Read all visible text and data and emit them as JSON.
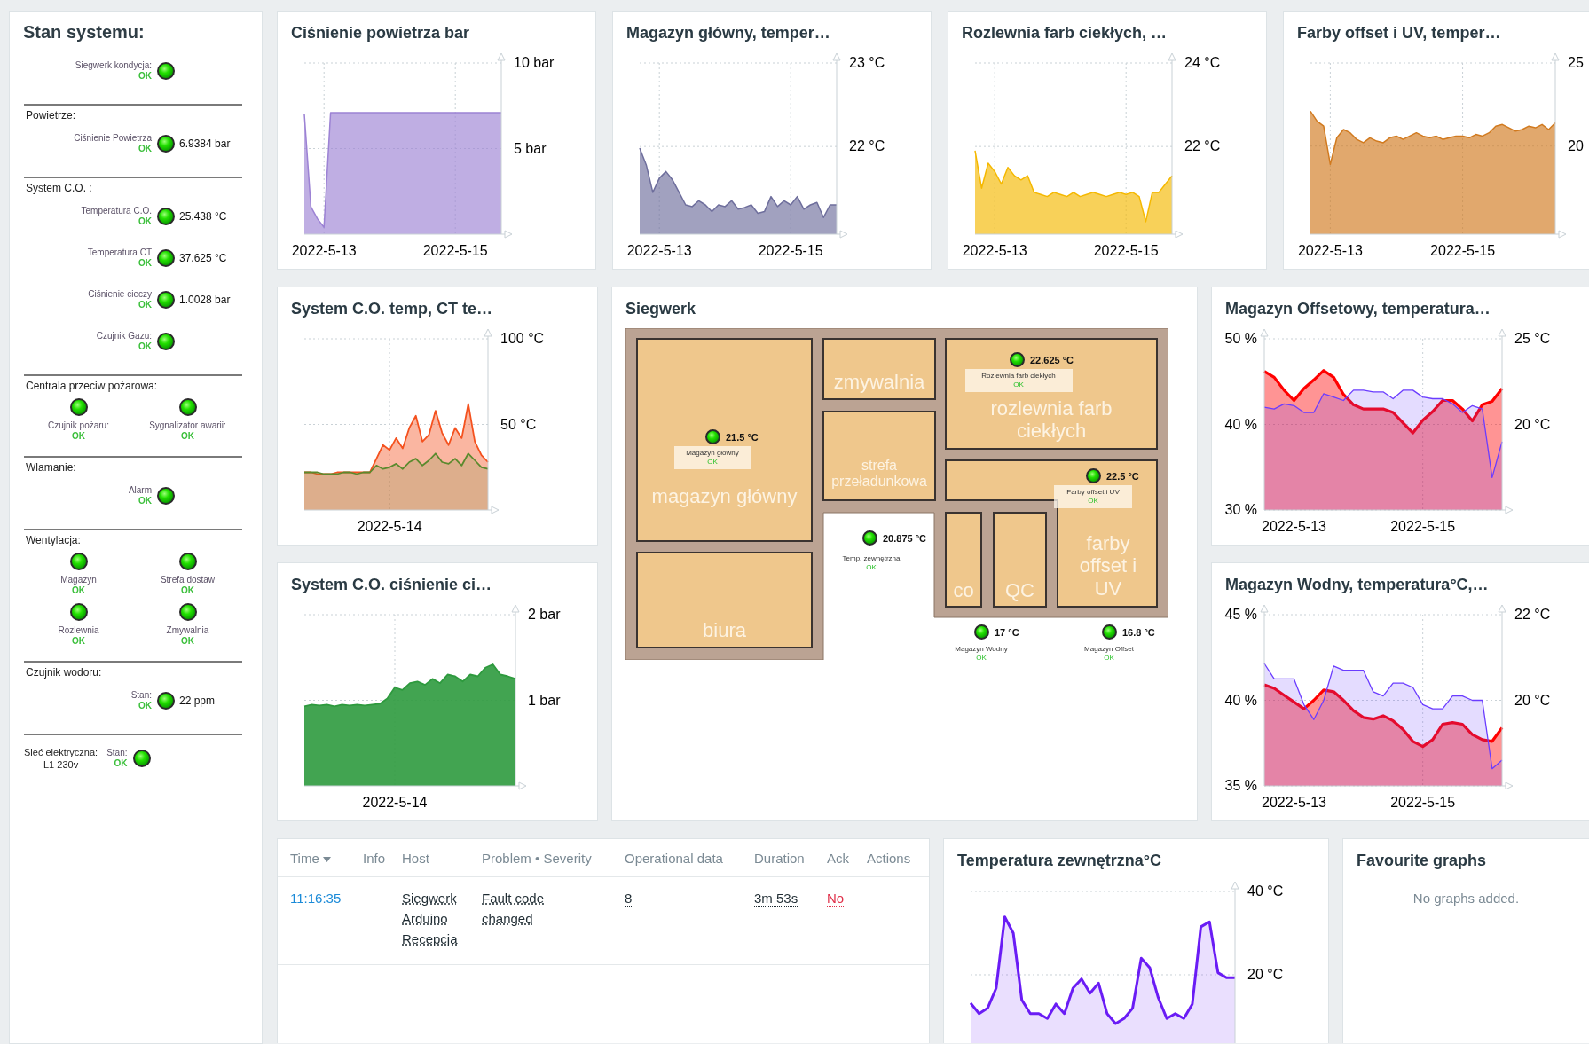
{
  "system_status": {
    "title": "Stan systemu:",
    "sections": [
      {
        "kind": "rows",
        "items": [
          {
            "label": "Siegwerk kondycja:",
            "status": "OK"
          }
        ]
      },
      {
        "kind": "rows",
        "heading": "Powietrze:",
        "items": [
          {
            "label": "Ciśnienie Powietrza",
            "status": "OK",
            "value": "6.9384 bar"
          }
        ]
      },
      {
        "kind": "rows",
        "heading": "System C.O. :",
        "items": [
          {
            "label": "Temperatura C.O.",
            "status": "OK",
            "value": "25.438 °C"
          },
          {
            "label": "Temperatura CT",
            "status": "OK",
            "value": "37.625 °C"
          },
          {
            "label": "Ciśnienie cieczy",
            "status": "OK",
            "value": "1.0028 bar"
          },
          {
            "label": "Czujnik Gazu:",
            "status": "OK"
          }
        ]
      },
      {
        "kind": "grid",
        "heading": "Centrala przeciw pożarowa:",
        "items": [
          {
            "label": "Czujnik pożaru:",
            "status": "OK"
          },
          {
            "label": "Sygnalizator awarii:",
            "status": "OK"
          }
        ]
      },
      {
        "kind": "rows",
        "heading": "Wlamanie:",
        "items": [
          {
            "label": "Alarm",
            "status": "OK"
          }
        ]
      },
      {
        "kind": "grid",
        "heading": "Wentylacja:",
        "items": [
          {
            "label": "Magazyn",
            "status": "OK"
          },
          {
            "label": "Strefa dostaw",
            "status": "OK"
          },
          {
            "label": "Rozlewnia",
            "status": "OK"
          },
          {
            "label": "Zmywalnia",
            "status": "OK"
          }
        ]
      },
      {
        "kind": "rows",
        "heading": "Czujnik wodoru:",
        "items": [
          {
            "label": "Stan:",
            "status": "OK",
            "value": "22 ppm"
          }
        ]
      },
      {
        "kind": "inline",
        "heading": "Sieć elektryczna:",
        "subheading": "L1 230v",
        "items": [
          {
            "label": "Stan:",
            "status": "OK"
          }
        ]
      }
    ]
  },
  "top_graphs": [
    {
      "title": "Ciśnienie powietrza bar",
      "chart_data": {
        "type": "area",
        "grid": true,
        "categories": [
          null,
          null,
          null,
          "2022-5-13",
          null,
          null,
          null,
          null,
          null,
          null,
          null,
          null,
          null,
          null,
          null,
          null,
          null,
          null,
          null,
          null,
          null,
          null,
          null,
          "2022-5-15",
          null,
          null,
          null,
          null,
          null,
          null,
          null
        ],
        "ylim": [
          0,
          10
        ],
        "yticks": [
          {
            "value": 10,
            "label": "10 bar"
          },
          {
            "value": 5,
            "label": "5 bar"
          }
        ],
        "series": [
          {
            "color": "#9c82d4",
            "values": [
              7.0,
              1.6,
              0.9,
              0.4,
              7.1,
              7.1,
              7.1,
              7.1,
              7.1,
              7.1,
              7.1,
              7.1,
              7.1,
              7.1,
              7.1,
              7.1,
              7.1,
              7.1,
              7.1,
              7.1,
              7.1,
              7.1,
              7.1,
              7.1,
              7.1,
              7.1,
              7.1,
              7.1,
              7.1,
              7.1,
              7.1
            ]
          }
        ]
      }
    },
    {
      "title": "Magazyn główny, temper…",
      "chart_data": {
        "type": "area",
        "grid": true,
        "categories": [
          null,
          null,
          null,
          "2022-5-13",
          null,
          null,
          null,
          null,
          null,
          null,
          null,
          null,
          null,
          null,
          null,
          null,
          null,
          null,
          null,
          null,
          null,
          null,
          null,
          "2022-5-15",
          null,
          null,
          null,
          null,
          null,
          null,
          null
        ],
        "ylim": [
          20.95,
          23
        ],
        "yticks": [
          {
            "value": 23,
            "label": "23 °C"
          },
          {
            "value": 22,
            "label": "22 °C"
          }
        ],
        "series": [
          {
            "color": "#6e6e9c",
            "values": [
              21.98,
              21.78,
              21.45,
              21.62,
              21.7,
              21.6,
              21.45,
              21.3,
              21.28,
              21.35,
              21.3,
              21.22,
              21.3,
              21.28,
              21.35,
              21.25,
              21.27,
              21.3,
              21.2,
              21.22,
              21.4,
              21.28,
              21.35,
              21.3,
              21.4,
              21.25,
              21.3,
              21.33,
              21.15,
              21.3,
              21.3
            ]
          }
        ]
      }
    },
    {
      "title": "Rozlewnia farb ciekłych, …",
      "chart_data": {
        "type": "area",
        "grid": true,
        "categories": [
          null,
          null,
          null,
          "2022-5-13",
          null,
          null,
          null,
          null,
          null,
          null,
          null,
          null,
          null,
          null,
          null,
          null,
          null,
          null,
          null,
          null,
          null,
          null,
          null,
          "2022-5-15",
          null,
          null,
          null,
          null,
          null,
          null,
          null
        ],
        "ylim": [
          19.9,
          24
        ],
        "yticks": [
          {
            "value": 24,
            "label": "24 °C"
          },
          {
            "value": 22,
            "label": "22 °C"
          }
        ],
        "series": [
          {
            "color": "#f5b800",
            "values": [
              21.9,
              21.0,
              21.6,
              21.4,
              21.1,
              21.5,
              21.3,
              21.2,
              21.3,
              20.9,
              20.85,
              20.8,
              20.9,
              20.85,
              20.8,
              20.9,
              20.8,
              20.85,
              20.9,
              20.85,
              20.8,
              20.85,
              20.9,
              20.85,
              20.9,
              20.8,
              20.2,
              20.9,
              20.9,
              21.1,
              21.3
            ]
          }
        ]
      }
    },
    {
      "title": "Farby offset i UV, temper…",
      "chart_data": {
        "type": "area",
        "grid": true,
        "categories": [
          null,
          null,
          null,
          "2022-5-13",
          null,
          null,
          null,
          null,
          null,
          null,
          null,
          null,
          null,
          null,
          null,
          null,
          null,
          null,
          null,
          null,
          null,
          null,
          null,
          "2022-5-15",
          null,
          null,
          null,
          null,
          null,
          null,
          null,
          null,
          null,
          null,
          null,
          null,
          null,
          null
        ],
        "ylim": [
          14.7,
          25
        ],
        "yticks": [
          {
            "value": 25,
            "label": "25"
          },
          {
            "value": 20,
            "label": "20"
          }
        ],
        "series": [
          {
            "color": "#d17a1f",
            "values": [
              22.1,
              21.5,
              21.2,
              18.9,
              20.5,
              21.0,
              20.8,
              20.4,
              20.2,
              20.5,
              20.3,
              20.2,
              20.5,
              20.6,
              20.4,
              20.6,
              20.8,
              20.6,
              20.5,
              20.6,
              20.4,
              20.5,
              20.6,
              20.6,
              20.5,
              20.7,
              20.6,
              20.8,
              21.2,
              21.3,
              21.1,
              20.9,
              21.0,
              21.2,
              21.1,
              21.3,
              21.0,
              21.4
            ]
          }
        ]
      }
    }
  ],
  "left_graphs": [
    {
      "title": "System C.O. temp, CT te…",
      "chart_data": {
        "type": "area",
        "grid": true,
        "categories": [
          null,
          null,
          null,
          null,
          null,
          null,
          null,
          null,
          null,
          null,
          null,
          null,
          null,
          "2022-5-14",
          null,
          null,
          null,
          null,
          null,
          null,
          null,
          null,
          null,
          null,
          null,
          null,
          null,
          null,
          null
        ],
        "ylim": [
          0,
          100
        ],
        "yticks": [
          {
            "value": 100,
            "label": "100 °C"
          },
          {
            "value": 50,
            "label": "50 °C"
          }
        ],
        "series": [
          {
            "color": "#f4511e",
            "values": [
              22,
              22,
              21,
              21,
              21,
              22,
              22,
              22,
              22,
              22,
              22,
              30,
              38,
              35,
              42,
              36,
              48,
              55,
              40,
              44,
              58,
              45,
              38,
              48,
              42,
              62,
              40,
              32,
              28
            ]
          },
          {
            "color": "#5b8a2e",
            "values": [
              22,
              22,
              22,
              21,
              21,
              21,
              22,
              22,
              21,
              22,
              22,
              26,
              24,
              25,
              27,
              24,
              28,
              30,
              26,
              29,
              33,
              28,
              27,
              30,
              26,
              33,
              29,
              25,
              24
            ]
          }
        ]
      }
    },
    {
      "title": "System C.O. ciśnienie ci…",
      "chart_data": {
        "type": "area",
        "grid": true,
        "categories": [
          null,
          null,
          null,
          null,
          null,
          null,
          null,
          null,
          null,
          null,
          null,
          null,
          "2022-5-14",
          null,
          null,
          null,
          null,
          null,
          null,
          null,
          null,
          null,
          null,
          null,
          null,
          null,
          null,
          null,
          null
        ],
        "ylim": [
          0,
          2
        ],
        "yticks": [
          {
            "value": 2,
            "label": "2 bar"
          },
          {
            "value": 1,
            "label": "1 bar"
          }
        ],
        "series": [
          {
            "color": "#2e9a3e",
            "values": [
              0.93,
              0.95,
              0.94,
              0.95,
              0.93,
              0.95,
              0.94,
              0.95,
              0.94,
              0.95,
              0.96,
              1.02,
              1.15,
              1.12,
              1.2,
              1.22,
              1.18,
              1.25,
              1.2,
              1.3,
              1.28,
              1.22,
              1.3,
              1.28,
              1.38,
              1.42,
              1.3,
              1.28,
              1.25
            ]
          }
        ]
      }
    }
  ],
  "siegwerk_map": {
    "title": "Siegwerk",
    "rooms": [
      {
        "label": "magazyn główny"
      },
      {
        "label": "biura"
      },
      {
        "label": "zmywalnia"
      },
      {
        "label": "strefa przeładunkowa"
      },
      {
        "label": "rozlewnia farb ciekłych"
      },
      {
        "label": "co"
      },
      {
        "label": "QC"
      },
      {
        "label": "farby offset i UV"
      }
    ],
    "sensors": [
      {
        "label": "Rozlewnia farb ciekłych",
        "status": "OK",
        "value": "22.625 °C"
      },
      {
        "label": "Magazyn główny",
        "status": "OK",
        "value": "21.5 °C"
      },
      {
        "label": "Farby offset i UV",
        "status": "OK",
        "value": "22.5 °C"
      },
      {
        "label": "Temp. zewnętrzna",
        "status": "OK",
        "value": "20.875 °C"
      },
      {
        "label": "Magazyn Wodny",
        "status": "OK",
        "value": "17 °C"
      },
      {
        "label": "Magazyn Offset",
        "status": "OK",
        "value": "16.8 °C"
      }
    ]
  },
  "right_graphs": [
    {
      "title": "Magazyn Offsetowy, temperatura…",
      "chart_data": {
        "type": "area",
        "grid": true,
        "categories": [
          null,
          null,
          null,
          "2022-5-13",
          null,
          null,
          null,
          null,
          null,
          null,
          null,
          null,
          null,
          null,
          null,
          null,
          "2022-5-15",
          null,
          null,
          null,
          null,
          null,
          null,
          null,
          null
        ],
        "ylim": [
          30,
          50
        ],
        "y2lim": [
          15,
          25
        ],
        "yticks": [
          {
            "value": 50,
            "label": "50 %"
          },
          {
            "value": 40,
            "label": "40 %"
          },
          {
            "value": 30,
            "label": "30 %"
          }
        ],
        "y2ticks": [
          {
            "value": 25,
            "label": "25 °C"
          },
          {
            "value": 20,
            "label": "20 °C"
          }
        ],
        "series": [
          {
            "color": "#ff0000",
            "values": [
              46.2,
              45.5,
              44,
              42.8,
              44.2,
              45.2,
              46.3,
              45.5,
              43.5,
              42.3,
              41.8,
              41.8,
              41.8,
              41.4,
              40.2,
              39,
              40.5,
              41.5,
              42.8,
              42.8,
              41.8,
              40.4,
              42.3,
              42.7,
              44.2
            ]
          },
          {
            "color": "#6a3cff",
            "axis": "y2",
            "values": [
              21.0,
              20.9,
              21.2,
              21.1,
              20.7,
              20.7,
              21.8,
              21.6,
              21.4,
              22.0,
              22.0,
              21.9,
              21.9,
              21.5,
              22.0,
              22.0,
              21.6,
              21.5,
              21.5,
              21.2,
              20.7,
              21.1,
              20.9,
              16.9,
              19.0
            ]
          }
        ]
      }
    },
    {
      "title": "Magazyn Wodny, temperatura°C,…",
      "chart_data": {
        "type": "area",
        "grid": true,
        "categories": [
          null,
          null,
          null,
          "2022-5-13",
          null,
          null,
          null,
          null,
          null,
          null,
          null,
          null,
          null,
          null,
          null,
          null,
          "2022-5-15",
          null,
          null,
          null,
          null,
          null,
          null,
          null,
          null
        ],
        "ylim": [
          35,
          45
        ],
        "y2lim": [
          18,
          22
        ],
        "yticks": [
          {
            "value": 45,
            "label": "45 %"
          },
          {
            "value": 40,
            "label": "40 %"
          },
          {
            "value": 35,
            "label": "35 %"
          }
        ],
        "y2ticks": [
          {
            "value": 22,
            "label": "22 °C"
          },
          {
            "value": 20,
            "label": "20 °C"
          }
        ],
        "series": [
          {
            "color": "#ff0000",
            "values": [
              40.9,
              40.7,
              40.3,
              39.9,
              39.5,
              40.0,
              40.6,
              40.5,
              40.0,
              39.4,
              39.0,
              38.9,
              39.1,
              38.8,
              38.3,
              37.6,
              37.3,
              37.7,
              38.6,
              38.7,
              38.6,
              38.0,
              37.7,
              37.6,
              38.4
            ]
          },
          {
            "color": "#6a3cff",
            "axis": "y2",
            "values": [
              20.86,
              20.5,
              20.5,
              20.5,
              19.9,
              19.55,
              20.0,
              20.8,
              20.7,
              20.7,
              20.7,
              20.2,
              20.1,
              20.4,
              20.4,
              20.3,
              19.9,
              19.8,
              19.8,
              20.1,
              20.1,
              20.0,
              20.0,
              18.4,
              18.6
            ]
          }
        ]
      }
    }
  ],
  "problems": {
    "columns": [
      {
        "label": "Time",
        "sorted": true
      },
      {
        "label": "Info",
        "sorted": false
      },
      {
        "label": "Host",
        "sorted": false
      },
      {
        "label": "Problem • Severity",
        "sorted": false
      },
      {
        "label": "Operational data",
        "sorted": false
      },
      {
        "label": "Duration",
        "sorted": false
      },
      {
        "label": "Ack",
        "sorted": false
      },
      {
        "label": "Actions",
        "sorted": false
      }
    ],
    "rows": [
      {
        "time": "11:16:35",
        "host": "Siegwerk Arduino Recepcja",
        "problem": "Fault code changed",
        "operational_data": "8",
        "duration": "3m 53s",
        "ack": "No"
      }
    ]
  },
  "outdoor_graph": {
    "title": "Temperatura zewnętrzna°C",
    "chart_data": {
      "type": "area",
      "grid": true,
      "categories": [
        null,
        null,
        null,
        null,
        null,
        null,
        null,
        null,
        null,
        null,
        null,
        null,
        null,
        null,
        null,
        null,
        null,
        null,
        null,
        null,
        null,
        null,
        null,
        null,
        null,
        null,
        null,
        null,
        null,
        null,
        null,
        null
      ],
      "ylim": [
        3.4,
        40
      ],
      "yticks": [
        {
          "value": 40,
          "label": "40 °C"
        },
        {
          "value": 20,
          "label": "20 °C"
        }
      ],
      "series": [
        {
          "color": "#6a1cf5",
          "values": [
            13.2,
            10.7,
            12,
            16.8,
            33.9,
            30,
            14,
            10.7,
            10.7,
            9.5,
            13,
            10.7,
            16.8,
            19,
            15.6,
            18,
            10.7,
            8.3,
            9.5,
            12,
            24,
            21.7,
            14.5,
            9.5,
            10.7,
            9.5,
            13,
            31.5,
            32.7,
            20.5,
            19.3,
            19.3
          ]
        }
      ]
    }
  },
  "favourite_graphs": {
    "title": "Favourite graphs",
    "message": "No graphs added."
  }
}
